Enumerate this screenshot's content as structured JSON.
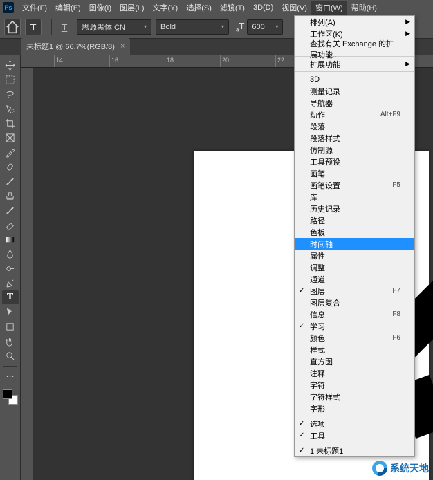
{
  "app_logo": "Ps",
  "menubar": {
    "file": "文件(F)",
    "edit": "编辑(E)",
    "image": "图像(I)",
    "layer": "图层(L)",
    "type": "文字(Y)",
    "select": "选择(S)",
    "filter": "滤镜(T)",
    "threeD": "3D(D)",
    "view": "视图(V)",
    "window": "窗口(W)",
    "help": "帮助(H)"
  },
  "options": {
    "tool_letter": "T",
    "orientation_letter": "T",
    "font_family": "思源黑体 CN",
    "font_weight": "Bold",
    "font_size_label": "T",
    "font_size": "600"
  },
  "document_tab": {
    "title": "未标题1 @ 66.7%(RGB/8)",
    "close": "×"
  },
  "ruler": {
    "labels": [
      "14",
      "16",
      "18",
      "20",
      "22"
    ]
  },
  "window_menu": {
    "arrange": "排列(A)",
    "workspace": "工作区(K)",
    "exchange": "查找有关 Exchange 的扩展功能...",
    "extensions": "扩展功能",
    "threeD": "3D",
    "measurement": "测量记录",
    "navigator": "导航器",
    "actions": "动作",
    "actions_shortcut": "Alt+F9",
    "paragraph": "段落",
    "paragraph_styles": "段落样式",
    "clone_source": "仿制源",
    "tool_presets": "工具预设",
    "brushes": "画笔",
    "brush_settings": "画笔设置",
    "brush_settings_shortcut": "F5",
    "library": "库",
    "history": "历史记录",
    "paths": "路径",
    "swatches": "色板",
    "timeline": "时间轴",
    "properties": "属性",
    "adjustments": "调整",
    "channels": "通道",
    "layers": "图层",
    "layers_shortcut": "F7",
    "layer_comps": "图层复合",
    "info": "信息",
    "info_shortcut": "F8",
    "learn": "学习",
    "color": "颜色",
    "color_shortcut": "F6",
    "styles": "样式",
    "histogram": "直方图",
    "notes": "注释",
    "character": "字符",
    "character_styles": "字符样式",
    "glyphs": "字形",
    "options": "选项",
    "tools": "工具",
    "doc1": "1 未标题1",
    "check": "✓",
    "submenu": "▶"
  },
  "watermark": "系统天地"
}
